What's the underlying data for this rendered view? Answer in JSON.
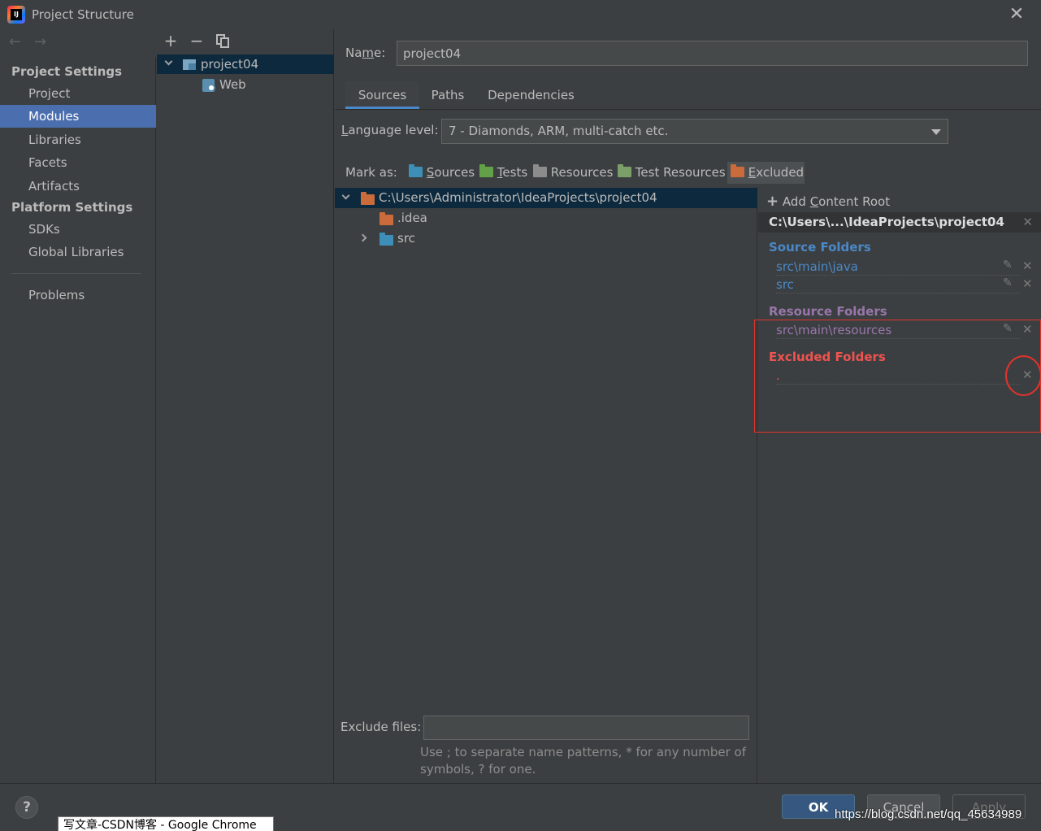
{
  "window": {
    "title": "Project Structure"
  },
  "nav": {
    "project_settings_header": "Project Settings",
    "platform_settings_header": "Platform Settings",
    "items": [
      "Project",
      "Modules",
      "Libraries",
      "Facets",
      "Artifacts"
    ],
    "platform_items": [
      "SDKs",
      "Global Libraries"
    ],
    "problems": "Problems",
    "selected": "Modules"
  },
  "modules": {
    "root": "project04",
    "child": "Web"
  },
  "name_field": {
    "label": "Name:",
    "value": "project04"
  },
  "tabs": [
    "Sources",
    "Paths",
    "Dependencies"
  ],
  "language_level": {
    "label": "Language level:",
    "value": "7 - Diamonds, ARM, multi-catch etc."
  },
  "mark_as": {
    "label": "Mark as:",
    "buttons": [
      "Sources",
      "Tests",
      "Resources",
      "Test Resources",
      "Excluded"
    ],
    "selected": "Excluded"
  },
  "tree": {
    "root": "C:\\Users\\Administrator\\IdeaProjects\\project04",
    "children": [
      ".idea",
      "src"
    ]
  },
  "content_root": {
    "add_label": "Add Content Root",
    "path": "C:\\Users\\...\\IdeaProjects\\project04",
    "source_title": "Source Folders",
    "source_folders": [
      "src\\main\\java",
      "src"
    ],
    "resource_title": "Resource Folders",
    "resource_folders": [
      "src\\main\\resources"
    ],
    "excluded_title": "Excluded Folders",
    "excluded_folders": [
      "."
    ]
  },
  "exclude_files": {
    "label": "Exclude files:",
    "value": "",
    "hint_line1": "Use ; to separate name patterns, * for any number of",
    "hint_line2": "symbols, ? for one."
  },
  "buttons": {
    "ok": "OK",
    "cancel": "Cancel",
    "apply": "Apply",
    "help": "?"
  },
  "taskbar_tooltip": "写文章-CSDN博客 - Google Chrome",
  "watermark": "https://blog.csdn.net/qq_45634989",
  "colors": {
    "background": "#3c3f41",
    "selection": "#4b6eaf",
    "tree_selection": "#0d293e",
    "source_title": "#4a88c7",
    "resource_title": "#9876aa",
    "excluded_title": "#ef5350",
    "annotation_red": "#e0332d"
  }
}
